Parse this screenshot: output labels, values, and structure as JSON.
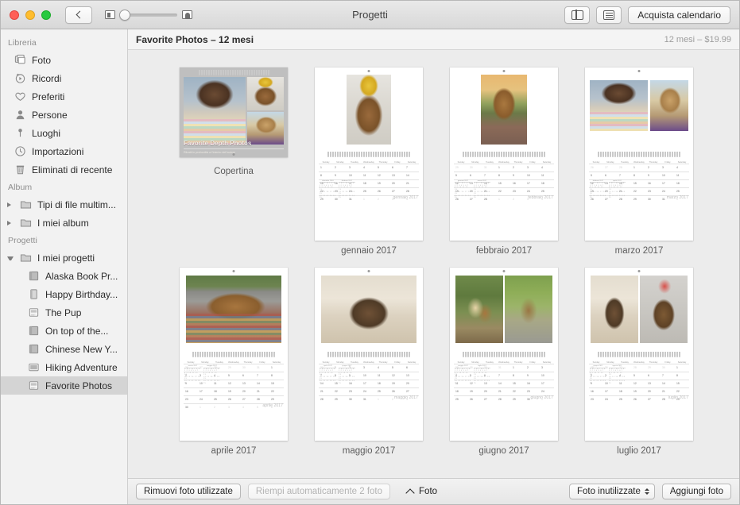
{
  "window": {
    "title": "Progetti",
    "traffic_lights": [
      "close",
      "minimize",
      "zoom"
    ]
  },
  "toolbar": {
    "back_label": "Indietro",
    "zoom_slider": {
      "min_icon": "small-photo-icon",
      "max_icon": "large-photo-icon",
      "value": 0
    },
    "split_view_label": "Vista divisa",
    "info_label": "Info",
    "buy_label": "Acquista calendario"
  },
  "sidebar": {
    "sections": [
      {
        "header": "Libreria",
        "items": [
          {
            "label": "Foto",
            "icon": "photos-stack-icon"
          },
          {
            "label": "Ricordi",
            "icon": "memories-play-icon"
          },
          {
            "label": "Preferiti",
            "icon": "heart-icon"
          },
          {
            "label": "Persone",
            "icon": "person-icon"
          },
          {
            "label": "Luoghi",
            "icon": "map-pin-icon"
          },
          {
            "label": "Importazioni",
            "icon": "clock-icon"
          },
          {
            "label": "Eliminati di recente",
            "icon": "trash-icon"
          }
        ]
      },
      {
        "header": "Album",
        "items": [
          {
            "label": "Tipi di file multim...",
            "icon": "folder-icon",
            "disclosure": "closed"
          },
          {
            "label": "I miei album",
            "icon": "folder-icon",
            "disclosure": "closed"
          }
        ]
      },
      {
        "header": "Progetti",
        "items": [
          {
            "label": "I miei progetti",
            "icon": "folder-icon",
            "disclosure": "open"
          },
          {
            "label": "Alaska Book Pr...",
            "icon": "book-project-icon"
          },
          {
            "label": "Happy Birthday...",
            "icon": "card-project-icon"
          },
          {
            "label": "The Pup",
            "icon": "calendar-project-icon"
          },
          {
            "label": "On top of the...",
            "icon": "book-project-icon"
          },
          {
            "label": "Chinese New Y...",
            "icon": "book-project-icon"
          },
          {
            "label": "Hiking Adventure",
            "icon": "slideshow-project-icon"
          },
          {
            "label": "Favorite Photos",
            "icon": "calendar-project-icon",
            "selected": true
          }
        ]
      }
    ]
  },
  "content_header": {
    "title": "Favorite Photos – 12 mesi",
    "price": "12 mesi – $19.99"
  },
  "calendar": {
    "day_headers": [
      "Sunday",
      "Monday",
      "Tuesday",
      "Wednesday",
      "Thursday",
      "Friday",
      "Saturday"
    ],
    "cover": {
      "caption": "Copertina",
      "title": "Favorite Depth Photos",
      "subtitle": "Ritratti in profondità a l'intento dell'autore",
      "photos": [
        "curly-hair-portrait",
        "dog-with-crown",
        "blonde-portrait"
      ]
    },
    "pages": [
      {
        "caption": "gennaio 2017",
        "month_label": "gennaio 2017",
        "layout": "single-portrait",
        "photos": [
          "dog-with-crown"
        ],
        "mini_calendars": false,
        "weeks": [
          [
            "1",
            "2",
            "3",
            "4",
            "5",
            "6",
            "7"
          ],
          [
            "8",
            "9",
            "10",
            "11",
            "12",
            "13",
            "14"
          ],
          [
            "15",
            "16",
            "17",
            "18",
            "19",
            "20",
            "21"
          ],
          [
            "22",
            "23",
            "24",
            "25",
            "26",
            "27",
            "28"
          ],
          [
            "29",
            "30",
            "31",
            "1",
            "2",
            "3",
            "4"
          ]
        ],
        "dim_from": 24
      },
      {
        "caption": "febbraio 2017",
        "month_label": "febbraio 2017",
        "layout": "single-portrait",
        "photos": [
          "dog-sunset-bench"
        ],
        "mini_calendars": false,
        "weeks": [
          [
            "29",
            "30",
            "31",
            "1",
            "2",
            "3",
            "4"
          ],
          [
            "5",
            "6",
            "7",
            "8",
            "9",
            "10",
            "11"
          ],
          [
            "12",
            "13",
            "14",
            "15",
            "16",
            "17",
            "18"
          ],
          [
            "19",
            "20",
            "21",
            "22",
            "23",
            "24",
            "25"
          ],
          [
            "26",
            "27",
            "28",
            "1",
            "2",
            "3",
            "4"
          ]
        ],
        "dim_from": 0
      },
      {
        "caption": "marzo 2017",
        "month_label": "marzo 2017",
        "layout": "two-landscape",
        "photos": [
          "curly-hair-portrait",
          "blonde-portrait"
        ],
        "mini_calendars": false,
        "weeks": [
          [
            "26",
            "27",
            "28",
            "1",
            "2",
            "3",
            "4"
          ],
          [
            "5",
            "6",
            "7",
            "8",
            "9",
            "10",
            "11"
          ],
          [
            "12",
            "13",
            "14",
            "15",
            "16",
            "17",
            "18"
          ],
          [
            "19",
            "20",
            "21",
            "22",
            "23",
            "24",
            "25"
          ],
          [
            "26",
            "27",
            "28",
            "29",
            "30",
            "31",
            "1"
          ]
        ],
        "dim_from": 0
      },
      {
        "caption": "aprile 2017",
        "month_label": "aprile 2017",
        "layout": "single-landscape",
        "photos": [
          "dog-on-rug"
        ],
        "mini_calendars": true,
        "weeks": [
          [
            "26",
            "27",
            "28",
            "29",
            "30",
            "31",
            "1"
          ],
          [
            "2",
            "3",
            "4",
            "5",
            "6",
            "7",
            "8"
          ],
          [
            "9",
            "10",
            "11",
            "12",
            "13",
            "14",
            "15"
          ],
          [
            "16",
            "17",
            "18",
            "19",
            "20",
            "21",
            "22"
          ],
          [
            "23",
            "24",
            "25",
            "26",
            "27",
            "28",
            "29"
          ],
          [
            "30",
            "1",
            "2",
            "3",
            "4",
            "5",
            "6"
          ]
        ],
        "dim_from": 0
      },
      {
        "caption": "maggio 2017",
        "month_label": "maggio 2017",
        "layout": "single-landscape",
        "photos": [
          "dog-in-blanket"
        ],
        "mini_calendars": true,
        "weeks": [
          [
            "30",
            "1",
            "2",
            "3",
            "4",
            "5",
            "6"
          ],
          [
            "7",
            "8",
            "9",
            "10",
            "11",
            "12",
            "13"
          ],
          [
            "14",
            "15",
            "16",
            "17",
            "18",
            "19",
            "20"
          ],
          [
            "21",
            "22",
            "23",
            "24",
            "25",
            "26",
            "27"
          ],
          [
            "28",
            "29",
            "30",
            "31",
            "1",
            "2",
            "3"
          ]
        ],
        "dim_from": 0
      },
      {
        "caption": "giugno 2017",
        "month_label": "giugno 2017",
        "layout": "two-portrait",
        "photos": [
          "girl-in-hammock",
          "dog-in-river"
        ],
        "mini_calendars": true,
        "weeks": [
          [
            "28",
            "29",
            "30",
            "31",
            "1",
            "2",
            "3"
          ],
          [
            "4",
            "5",
            "6",
            "7",
            "8",
            "9",
            "10"
          ],
          [
            "11",
            "12",
            "13",
            "14",
            "15",
            "16",
            "17"
          ],
          [
            "18",
            "19",
            "20",
            "21",
            "22",
            "23",
            "24"
          ],
          [
            "25",
            "26",
            "27",
            "28",
            "29",
            "30",
            "1"
          ]
        ],
        "dim_from": 0
      },
      {
        "caption": "luglio 2017",
        "month_label": "luglio 2017",
        "layout": "two-portrait",
        "photos": [
          "dog-in-hood",
          "dog-party-hat"
        ],
        "mini_calendars": false,
        "weeks": [
          [
            "25",
            "26",
            "27",
            "28",
            "29",
            "30",
            "1"
          ],
          [
            "2",
            "3",
            "4",
            "5",
            "6",
            "7",
            "8"
          ],
          [
            "9",
            "10",
            "11",
            "12",
            "13",
            "14",
            "15"
          ],
          [
            "16",
            "17",
            "18",
            "19",
            "20",
            "21",
            "22"
          ],
          [
            "23",
            "24",
            "25",
            "26",
            "27",
            "28",
            "29"
          ]
        ],
        "dim_from": 0
      }
    ]
  },
  "bottombar": {
    "remove_used_label": "Rimuovi foto utilizzate",
    "autofill_label": "Riempi automaticamente 2 foto",
    "photos_label": "Foto",
    "filter_label": "Foto inutilizzate",
    "add_photos_label": "Aggiungi foto"
  },
  "colors": {
    "selection": "#d4d4d4",
    "sidebar_bg": "#f2f2f2",
    "canvas_bg": "#ececec",
    "header_text": "#2b2b2b",
    "muted_text": "#9d9d9d"
  }
}
